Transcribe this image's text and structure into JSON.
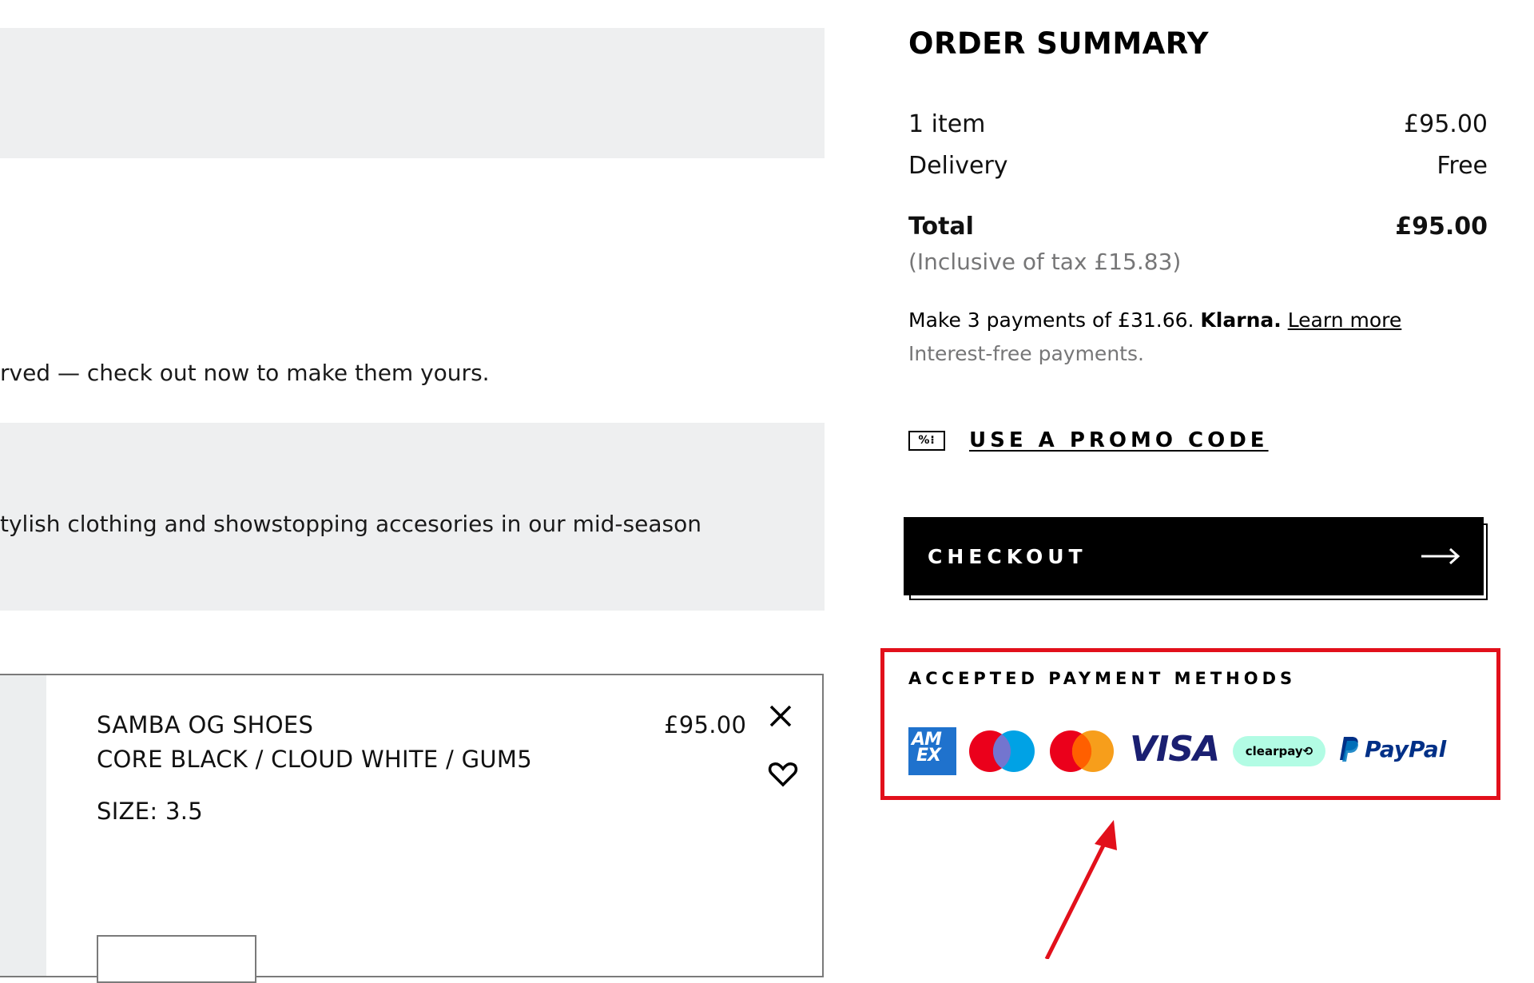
{
  "left": {
    "reserved_text": "rved — check out now to make them yours.",
    "promo_banner_text": "tylish clothing and showstopping accesories in our mid-season"
  },
  "cart_item": {
    "name": "SAMBA OG SHOES",
    "color": "CORE BLACK / CLOUD WHITE / GUM5",
    "size": "SIZE: 3.5",
    "price": "£95.00",
    "remove_icon": "close-icon",
    "wishlist_icon": "heart-icon"
  },
  "summary": {
    "title": "ORDER SUMMARY",
    "items_label": "1 item",
    "items_value": "£95.00",
    "delivery_label": "Delivery",
    "delivery_value": "Free",
    "total_label": "Total",
    "total_value": "£95.00",
    "tax_note": "(Inclusive of tax  £15.83)",
    "klarna_prefix": "Make 3 payments of £31.66.",
    "klarna_brand": "Klarna.",
    "klarna_link": "Learn more",
    "klarna_sub": "Interest-free payments."
  },
  "promo": {
    "icon_text": "%⁝",
    "label": "USE A PROMO CODE"
  },
  "checkout": {
    "label": "CHECKOUT",
    "icon": "arrow-right-icon"
  },
  "payment": {
    "title": "ACCEPTED PAYMENT METHODS",
    "amex_top": "AM",
    "amex_bottom": "EX",
    "visa": "VISA",
    "clearpay": "clearpay⟲",
    "paypal": "PayPal",
    "methods": [
      "amex-icon",
      "maestro-icon",
      "mastercard-icon",
      "visa-icon",
      "clearpay-icon",
      "paypal-icon"
    ]
  },
  "colors": {
    "annotation_red": "#e2101b",
    "banner_gray": "#eeeff0",
    "muted_text": "#767677"
  }
}
